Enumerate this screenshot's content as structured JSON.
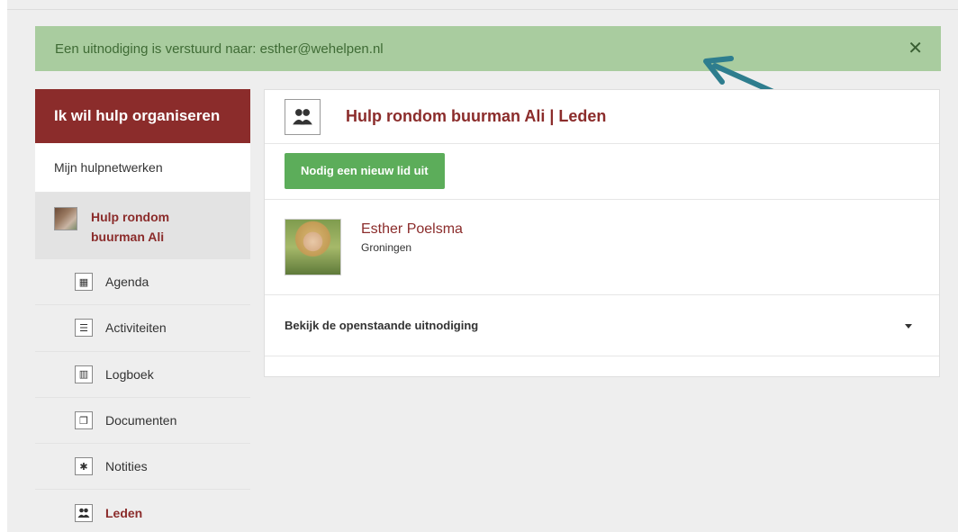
{
  "alert": {
    "message": "Een uitnodiging is verstuurd naar: esther@wehelpen.nl",
    "close_glyph": "✕"
  },
  "sidebar": {
    "header": "Ik wil hulp organiseren",
    "my_networks": "Mijn hulpnetwerken",
    "network": {
      "name": "Hulp rondom buurman Ali"
    },
    "items": [
      {
        "label": "Agenda",
        "icon": "calendar-icon",
        "glyph": "▦"
      },
      {
        "label": "Activiteiten",
        "icon": "list-icon",
        "glyph": "☰"
      },
      {
        "label": "Logboek",
        "icon": "book-icon",
        "glyph": "▥"
      },
      {
        "label": "Documenten",
        "icon": "documents-icon",
        "glyph": "❐"
      },
      {
        "label": "Notities",
        "icon": "pin-icon",
        "glyph": "✱"
      },
      {
        "label": "Leden",
        "icon": "members-icon",
        "glyph": "👥"
      }
    ]
  },
  "main": {
    "title": "Hulp rondom buurman Ali | Leden",
    "invite_button": "Nodig een nieuw lid uit",
    "member": {
      "name": "Esther Poelsma",
      "city": "Groningen"
    },
    "pending_label": "Bekijk de openstaande uitnodiging"
  },
  "colors": {
    "brand": "#8b2c2b",
    "alert_bg": "#a9cc9f",
    "button": "#5cad5a",
    "arrow": "#2e7d8e"
  }
}
